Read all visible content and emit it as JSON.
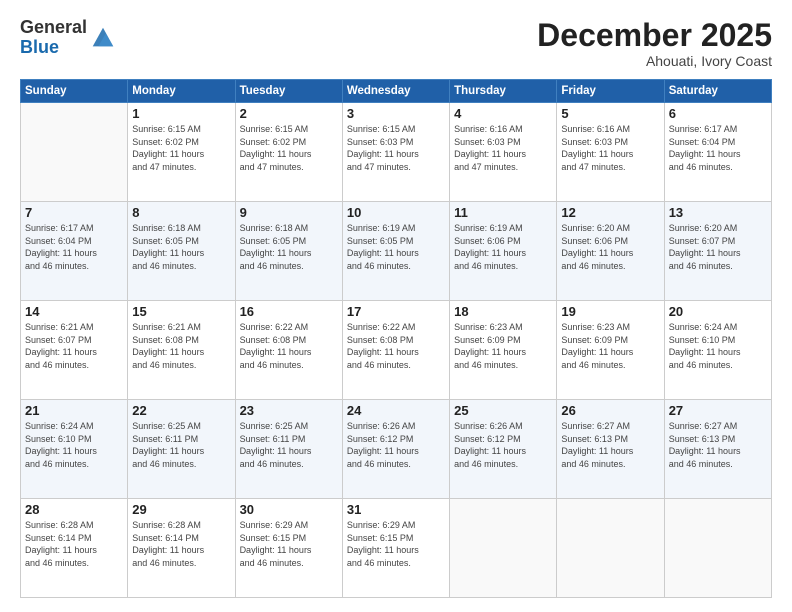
{
  "header": {
    "logo_general": "General",
    "logo_blue": "Blue",
    "month": "December 2025",
    "location": "Ahouati, Ivory Coast"
  },
  "days_of_week": [
    "Sunday",
    "Monday",
    "Tuesday",
    "Wednesday",
    "Thursday",
    "Friday",
    "Saturday"
  ],
  "weeks": [
    [
      {
        "day": "",
        "info": ""
      },
      {
        "day": "1",
        "info": "Sunrise: 6:15 AM\nSunset: 6:02 PM\nDaylight: 11 hours\nand 47 minutes."
      },
      {
        "day": "2",
        "info": "Sunrise: 6:15 AM\nSunset: 6:02 PM\nDaylight: 11 hours\nand 47 minutes."
      },
      {
        "day": "3",
        "info": "Sunrise: 6:15 AM\nSunset: 6:03 PM\nDaylight: 11 hours\nand 47 minutes."
      },
      {
        "day": "4",
        "info": "Sunrise: 6:16 AM\nSunset: 6:03 PM\nDaylight: 11 hours\nand 47 minutes."
      },
      {
        "day": "5",
        "info": "Sunrise: 6:16 AM\nSunset: 6:03 PM\nDaylight: 11 hours\nand 47 minutes."
      },
      {
        "day": "6",
        "info": "Sunrise: 6:17 AM\nSunset: 6:04 PM\nDaylight: 11 hours\nand 46 minutes."
      }
    ],
    [
      {
        "day": "7",
        "info": "Sunrise: 6:17 AM\nSunset: 6:04 PM\nDaylight: 11 hours\nand 46 minutes."
      },
      {
        "day": "8",
        "info": "Sunrise: 6:18 AM\nSunset: 6:05 PM\nDaylight: 11 hours\nand 46 minutes."
      },
      {
        "day": "9",
        "info": "Sunrise: 6:18 AM\nSunset: 6:05 PM\nDaylight: 11 hours\nand 46 minutes."
      },
      {
        "day": "10",
        "info": "Sunrise: 6:19 AM\nSunset: 6:05 PM\nDaylight: 11 hours\nand 46 minutes."
      },
      {
        "day": "11",
        "info": "Sunrise: 6:19 AM\nSunset: 6:06 PM\nDaylight: 11 hours\nand 46 minutes."
      },
      {
        "day": "12",
        "info": "Sunrise: 6:20 AM\nSunset: 6:06 PM\nDaylight: 11 hours\nand 46 minutes."
      },
      {
        "day": "13",
        "info": "Sunrise: 6:20 AM\nSunset: 6:07 PM\nDaylight: 11 hours\nand 46 minutes."
      }
    ],
    [
      {
        "day": "14",
        "info": "Sunrise: 6:21 AM\nSunset: 6:07 PM\nDaylight: 11 hours\nand 46 minutes."
      },
      {
        "day": "15",
        "info": "Sunrise: 6:21 AM\nSunset: 6:08 PM\nDaylight: 11 hours\nand 46 minutes."
      },
      {
        "day": "16",
        "info": "Sunrise: 6:22 AM\nSunset: 6:08 PM\nDaylight: 11 hours\nand 46 minutes."
      },
      {
        "day": "17",
        "info": "Sunrise: 6:22 AM\nSunset: 6:08 PM\nDaylight: 11 hours\nand 46 minutes."
      },
      {
        "day": "18",
        "info": "Sunrise: 6:23 AM\nSunset: 6:09 PM\nDaylight: 11 hours\nand 46 minutes."
      },
      {
        "day": "19",
        "info": "Sunrise: 6:23 AM\nSunset: 6:09 PM\nDaylight: 11 hours\nand 46 minutes."
      },
      {
        "day": "20",
        "info": "Sunrise: 6:24 AM\nSunset: 6:10 PM\nDaylight: 11 hours\nand 46 minutes."
      }
    ],
    [
      {
        "day": "21",
        "info": "Sunrise: 6:24 AM\nSunset: 6:10 PM\nDaylight: 11 hours\nand 46 minutes."
      },
      {
        "day": "22",
        "info": "Sunrise: 6:25 AM\nSunset: 6:11 PM\nDaylight: 11 hours\nand 46 minutes."
      },
      {
        "day": "23",
        "info": "Sunrise: 6:25 AM\nSunset: 6:11 PM\nDaylight: 11 hours\nand 46 minutes."
      },
      {
        "day": "24",
        "info": "Sunrise: 6:26 AM\nSunset: 6:12 PM\nDaylight: 11 hours\nand 46 minutes."
      },
      {
        "day": "25",
        "info": "Sunrise: 6:26 AM\nSunset: 6:12 PM\nDaylight: 11 hours\nand 46 minutes."
      },
      {
        "day": "26",
        "info": "Sunrise: 6:27 AM\nSunset: 6:13 PM\nDaylight: 11 hours\nand 46 minutes."
      },
      {
        "day": "27",
        "info": "Sunrise: 6:27 AM\nSunset: 6:13 PM\nDaylight: 11 hours\nand 46 minutes."
      }
    ],
    [
      {
        "day": "28",
        "info": "Sunrise: 6:28 AM\nSunset: 6:14 PM\nDaylight: 11 hours\nand 46 minutes."
      },
      {
        "day": "29",
        "info": "Sunrise: 6:28 AM\nSunset: 6:14 PM\nDaylight: 11 hours\nand 46 minutes."
      },
      {
        "day": "30",
        "info": "Sunrise: 6:29 AM\nSunset: 6:15 PM\nDaylight: 11 hours\nand 46 minutes."
      },
      {
        "day": "31",
        "info": "Sunrise: 6:29 AM\nSunset: 6:15 PM\nDaylight: 11 hours\nand 46 minutes."
      },
      {
        "day": "",
        "info": ""
      },
      {
        "day": "",
        "info": ""
      },
      {
        "day": "",
        "info": ""
      }
    ]
  ]
}
